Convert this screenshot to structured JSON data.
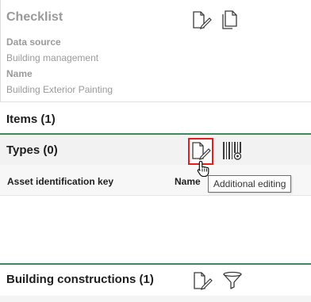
{
  "checklist": {
    "title": "Checklist",
    "icons": [
      "edit-document-icon",
      "copy-document-icon"
    ],
    "data_source_label": "Data source",
    "data_source_value": "Building management",
    "name_label": "Name",
    "name_value": "Building Exterior Painting"
  },
  "items": {
    "title": "Items (1)"
  },
  "types": {
    "title": "Types (0)",
    "icons": [
      "edit-document-icon",
      "asset-barcode-icon"
    ],
    "columns": [
      "Asset identification key",
      "Name"
    ],
    "tooltip": "Additional editing"
  },
  "building_constructions": {
    "title": "Building constructions (1)",
    "icons": [
      "edit-document-icon",
      "filter-icon"
    ]
  },
  "colors": {
    "accent_green": "#3f8a5a",
    "highlight_red": "#e02020",
    "muted_text": "#9a9a9a"
  }
}
